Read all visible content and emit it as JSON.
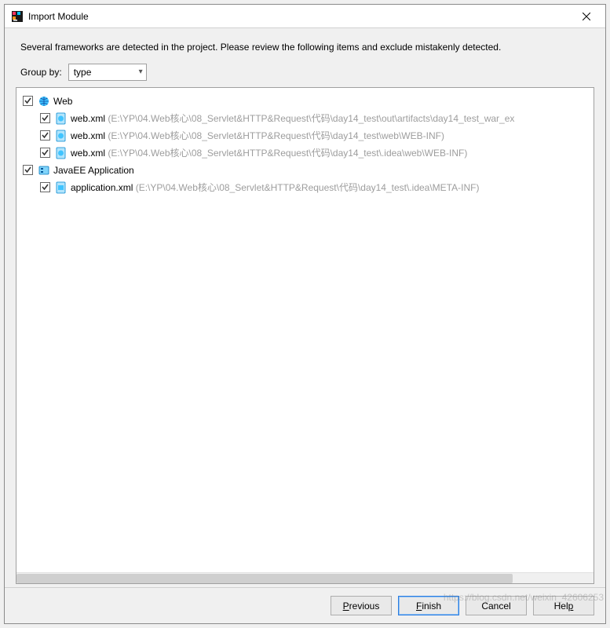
{
  "titlebar": {
    "title": "Import Module",
    "close_tooltip": "Close"
  },
  "description": "Several frameworks are detected in the project. Please review the following items and exclude mistakenly detected.",
  "groupby": {
    "label": "Group by:",
    "selected": "type"
  },
  "tree": {
    "groups": [
      {
        "label": "Web",
        "items": [
          {
            "name": "web.xml",
            "path": "(E:\\YP\\04.Web核心\\08_Servlet&HTTP&Request\\代码\\day14_test\\out\\artifacts\\day14_test_war_ex"
          },
          {
            "name": "web.xml",
            "path": "(E:\\YP\\04.Web核心\\08_Servlet&HTTP&Request\\代码\\day14_test\\web\\WEB-INF)"
          },
          {
            "name": "web.xml",
            "path": "(E:\\YP\\04.Web核心\\08_Servlet&HTTP&Request\\代码\\day14_test\\.idea\\web\\WEB-INF)"
          }
        ]
      },
      {
        "label": "JavaEE Application",
        "items": [
          {
            "name": "application.xml",
            "path": "(E:\\YP\\04.Web核心\\08_Servlet&HTTP&Request\\代码\\day14_test\\.idea\\META-INF)"
          }
        ]
      }
    ]
  },
  "buttons": {
    "previous": "Previous",
    "finish": "Finish",
    "cancel": "Cancel",
    "help": "Help"
  },
  "mnemonics": {
    "previous_letter": "P",
    "previous_rest": "revious",
    "finish_letter": "F",
    "finish_rest": "inish",
    "help_letter": "p"
  },
  "watermark": "https://blog.csdn.net/weixin_42606253"
}
